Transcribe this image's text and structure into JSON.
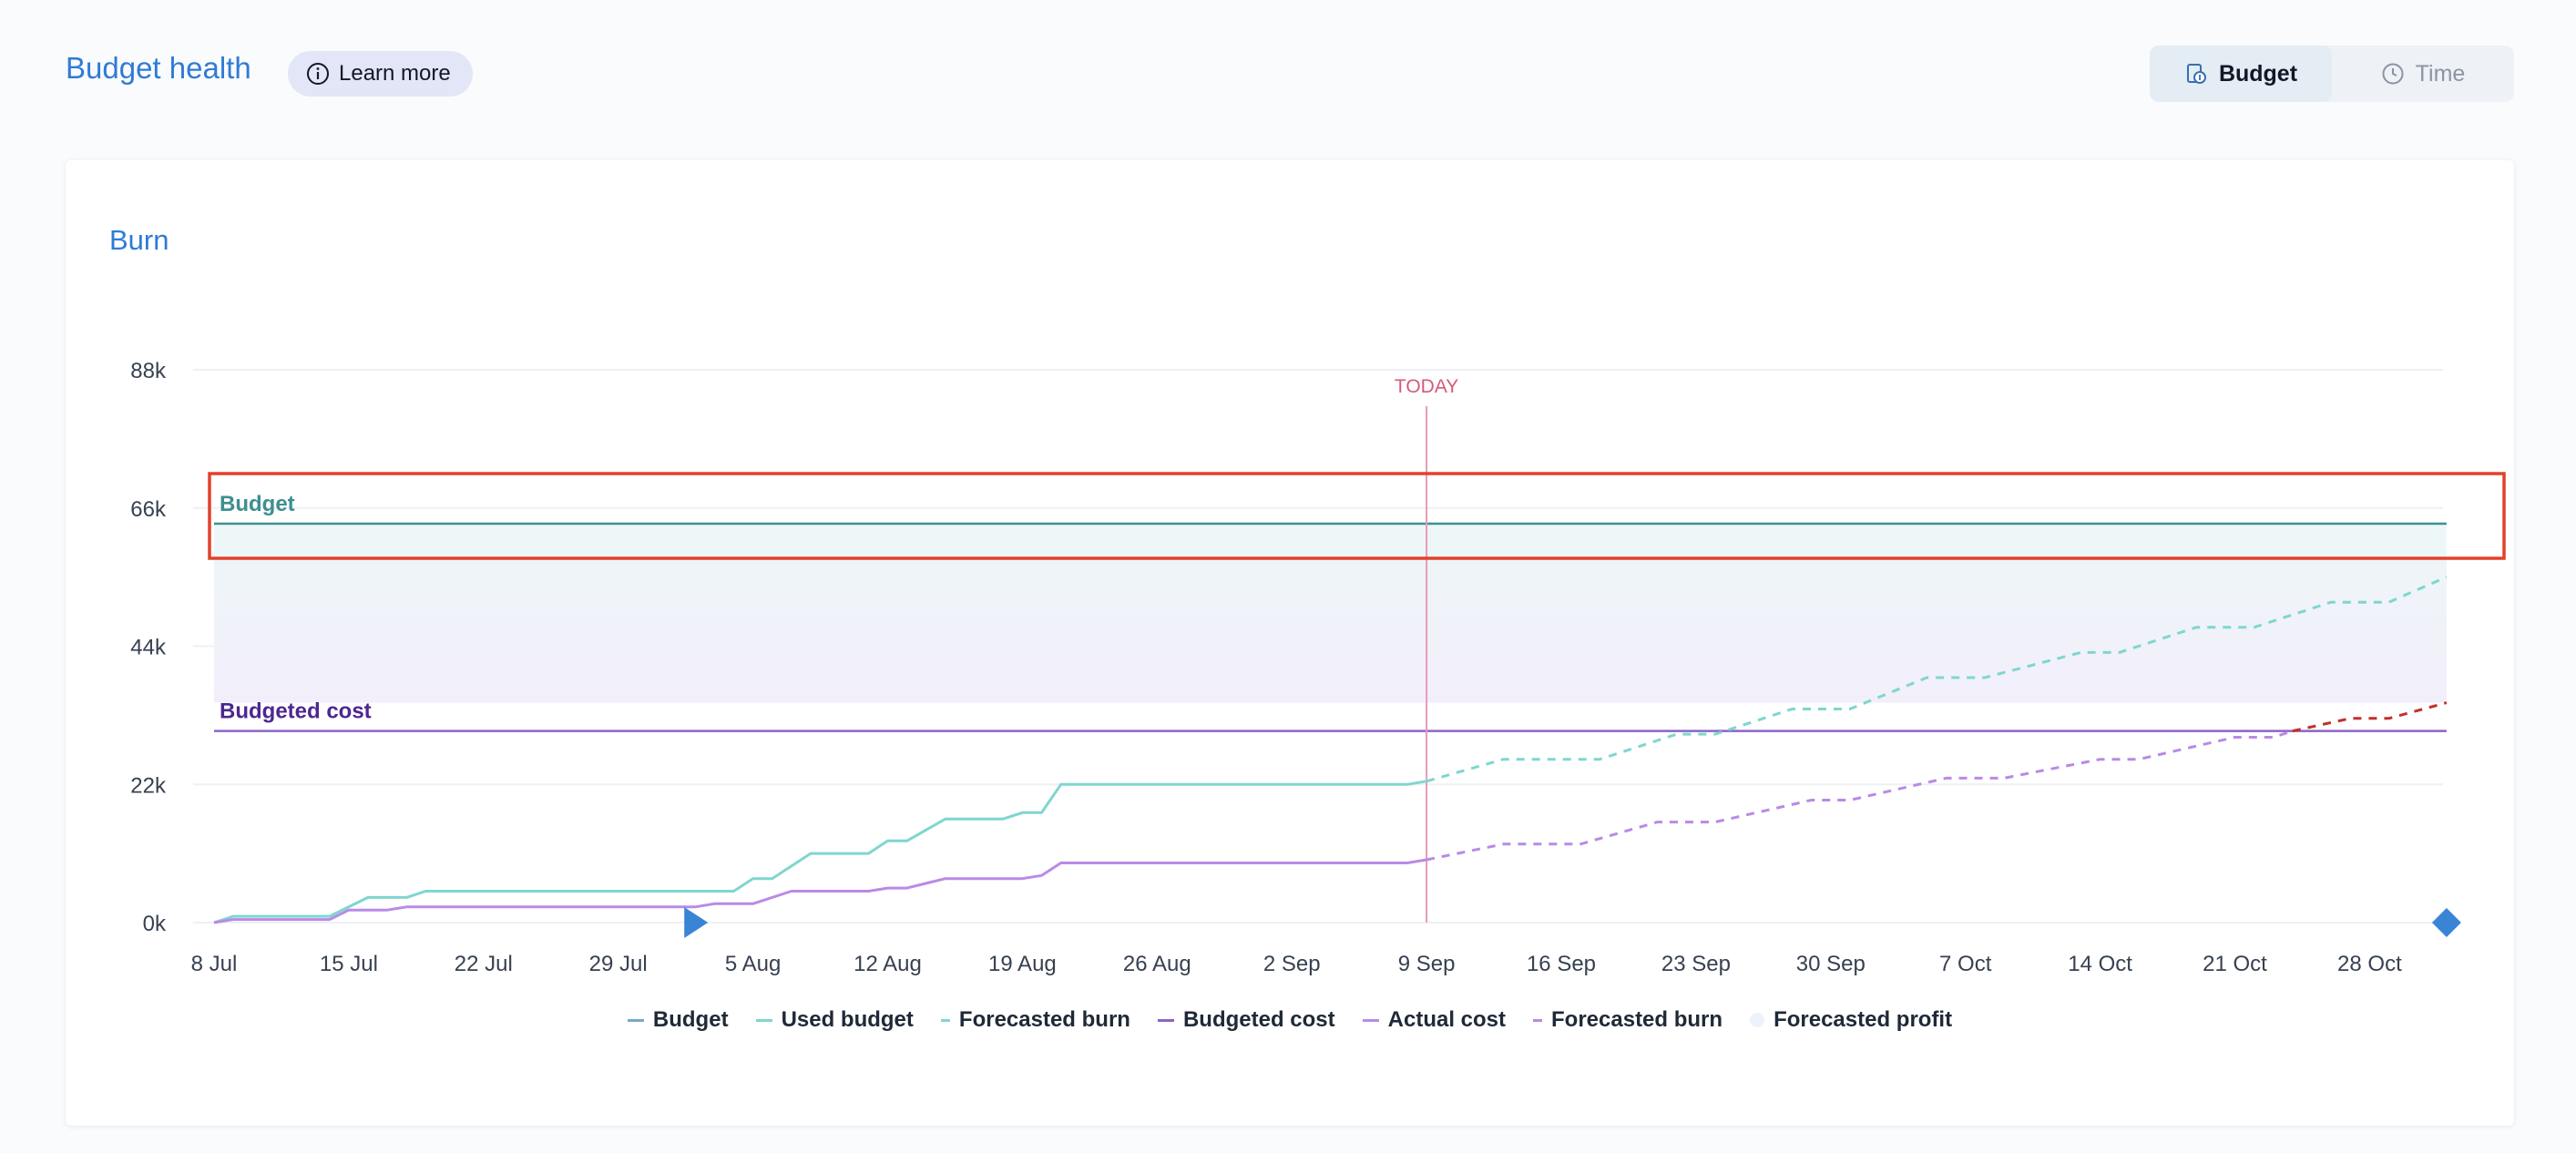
{
  "header": {
    "title": "Budget health",
    "learn_more_label": "Learn more"
  },
  "toggle": {
    "budget_label": "Budget",
    "time_label": "Time",
    "selected": "Budget"
  },
  "card": {
    "title": "Burn"
  },
  "chart_data": {
    "type": "line",
    "title": "",
    "xlabel": "",
    "ylabel": "",
    "x_ticks": [
      "8 Jul",
      "15 Jul",
      "22 Jul",
      "29 Jul",
      "5 Aug",
      "12 Aug",
      "19 Aug",
      "26 Aug",
      "2 Sep",
      "9 Sep",
      "16 Sep",
      "23 Sep",
      "30 Sep",
      "7 Oct",
      "14 Oct",
      "21 Oct",
      "28 Oct"
    ],
    "y_ticks": [
      "0k",
      "22k",
      "44k",
      "66k",
      "88k"
    ],
    "ylim": [
      0,
      88000
    ],
    "x_range": [
      "2024-07-08",
      "2024-11-01"
    ],
    "today": {
      "label": "TODAY",
      "date": "2024-09-09"
    },
    "grid": "horizontal",
    "budget": {
      "label": "Budget",
      "value": 63500,
      "color": "#3d8f8f"
    },
    "budgeted_cost": {
      "label": "Budgeted cost",
      "value": 30500,
      "color": "#8e63c7"
    },
    "forecasted_profit_band": {
      "from": 35000,
      "to": 58500
    },
    "start_marker_date": "2024-08-02",
    "end_marker_date": "2024-11-01",
    "series": [
      {
        "name": "Used budget",
        "style": "solid",
        "color": "#7fd6cf",
        "points": [
          [
            "2024-07-08",
            0
          ],
          [
            "2024-07-09",
            1000
          ],
          [
            "2024-07-14",
            1000
          ],
          [
            "2024-07-16",
            4000
          ],
          [
            "2024-07-18",
            4000
          ],
          [
            "2024-07-19",
            5000
          ],
          [
            "2024-08-04",
            5000
          ],
          [
            "2024-08-05",
            7000
          ],
          [
            "2024-08-06",
            7000
          ],
          [
            "2024-08-08",
            11000
          ],
          [
            "2024-08-11",
            11000
          ],
          [
            "2024-08-12",
            13000
          ],
          [
            "2024-08-13",
            13000
          ],
          [
            "2024-08-15",
            16500
          ],
          [
            "2024-08-18",
            16500
          ],
          [
            "2024-08-19",
            17500
          ],
          [
            "2024-08-20",
            17500
          ],
          [
            "2024-08-21",
            22000
          ],
          [
            "2024-09-08",
            22000
          ],
          [
            "2024-09-09",
            22500
          ]
        ]
      },
      {
        "name": "Forecasted burn",
        "style": "dashed",
        "color": "#7fd6cf",
        "points": [
          [
            "2024-09-09",
            22500
          ],
          [
            "2024-09-13",
            26000
          ],
          [
            "2024-09-18",
            26000
          ],
          [
            "2024-09-22",
            30000
          ],
          [
            "2024-09-24",
            30000
          ],
          [
            "2024-09-28",
            34000
          ],
          [
            "2024-10-01",
            34000
          ],
          [
            "2024-10-05",
            39000
          ],
          [
            "2024-10-08",
            39000
          ],
          [
            "2024-10-13",
            43000
          ],
          [
            "2024-10-15",
            43000
          ],
          [
            "2024-10-19",
            47000
          ],
          [
            "2024-10-22",
            47000
          ],
          [
            "2024-10-26",
            51000
          ],
          [
            "2024-10-29",
            51000
          ],
          [
            "2024-11-01",
            55000
          ]
        ]
      },
      {
        "name": "Actual cost",
        "style": "solid",
        "color": "#b98ae6",
        "points": [
          [
            "2024-07-08",
            0
          ],
          [
            "2024-07-09",
            500
          ],
          [
            "2024-07-14",
            500
          ],
          [
            "2024-07-15",
            2000
          ],
          [
            "2024-07-17",
            2000
          ],
          [
            "2024-07-18",
            2500
          ],
          [
            "2024-08-02",
            2500
          ],
          [
            "2024-08-03",
            3000
          ],
          [
            "2024-08-05",
            3000
          ],
          [
            "2024-08-07",
            5000
          ],
          [
            "2024-08-11",
            5000
          ],
          [
            "2024-08-12",
            5500
          ],
          [
            "2024-08-13",
            5500
          ],
          [
            "2024-08-15",
            7000
          ],
          [
            "2024-08-19",
            7000
          ],
          [
            "2024-08-20",
            7500
          ],
          [
            "2024-08-21",
            9500
          ],
          [
            "2024-09-08",
            9500
          ],
          [
            "2024-09-09",
            10000
          ]
        ]
      },
      {
        "name": "Forecasted burn",
        "style": "dashed",
        "color": "#b98ae6",
        "points": [
          [
            "2024-09-09",
            10000
          ],
          [
            "2024-09-13",
            12500
          ],
          [
            "2024-09-17",
            12500
          ],
          [
            "2024-09-21",
            16000
          ],
          [
            "2024-09-24",
            16000
          ],
          [
            "2024-09-29",
            19500
          ],
          [
            "2024-10-01",
            19500
          ],
          [
            "2024-10-06",
            23000
          ],
          [
            "2024-10-09",
            23000
          ],
          [
            "2024-10-14",
            26000
          ],
          [
            "2024-10-16",
            26000
          ],
          [
            "2024-10-21",
            29500
          ],
          [
            "2024-10-23",
            29500
          ],
          [
            "2024-10-24",
            30500
          ]
        ]
      },
      {
        "name": "Forecasted burn (over budgeted cost)",
        "style": "dashed",
        "color": "#c0312b",
        "points": [
          [
            "2024-10-24",
            30500
          ],
          [
            "2024-10-27",
            32500
          ],
          [
            "2024-10-29",
            32500
          ],
          [
            "2024-11-01",
            35000
          ]
        ]
      }
    ],
    "legend": [
      {
        "label": "Budget",
        "color": "#7aa7c7",
        "style": "solid"
      },
      {
        "label": "Used budget",
        "color": "#7fd6cf",
        "style": "solid"
      },
      {
        "label": "Forecasted burn",
        "color": "#7fd6cf",
        "style": "dashed"
      },
      {
        "label": "Budgeted cost",
        "color": "#8e63c7",
        "style": "solid"
      },
      {
        "label": "Actual cost",
        "color": "#b98ae6",
        "style": "solid"
      },
      {
        "label": "Forecasted burn",
        "color": "#b98ae6",
        "style": "dashed"
      },
      {
        "label": "Forecasted profit",
        "color": "#eef2fb",
        "style": "dot"
      }
    ],
    "legend_position": "bottom"
  },
  "colors": {
    "accent": "#2f7bd6",
    "today_line": "#e79ab8",
    "today_label": "#d45a7a",
    "highlight_box": "#e2412a",
    "markers": "#3a84d6"
  }
}
